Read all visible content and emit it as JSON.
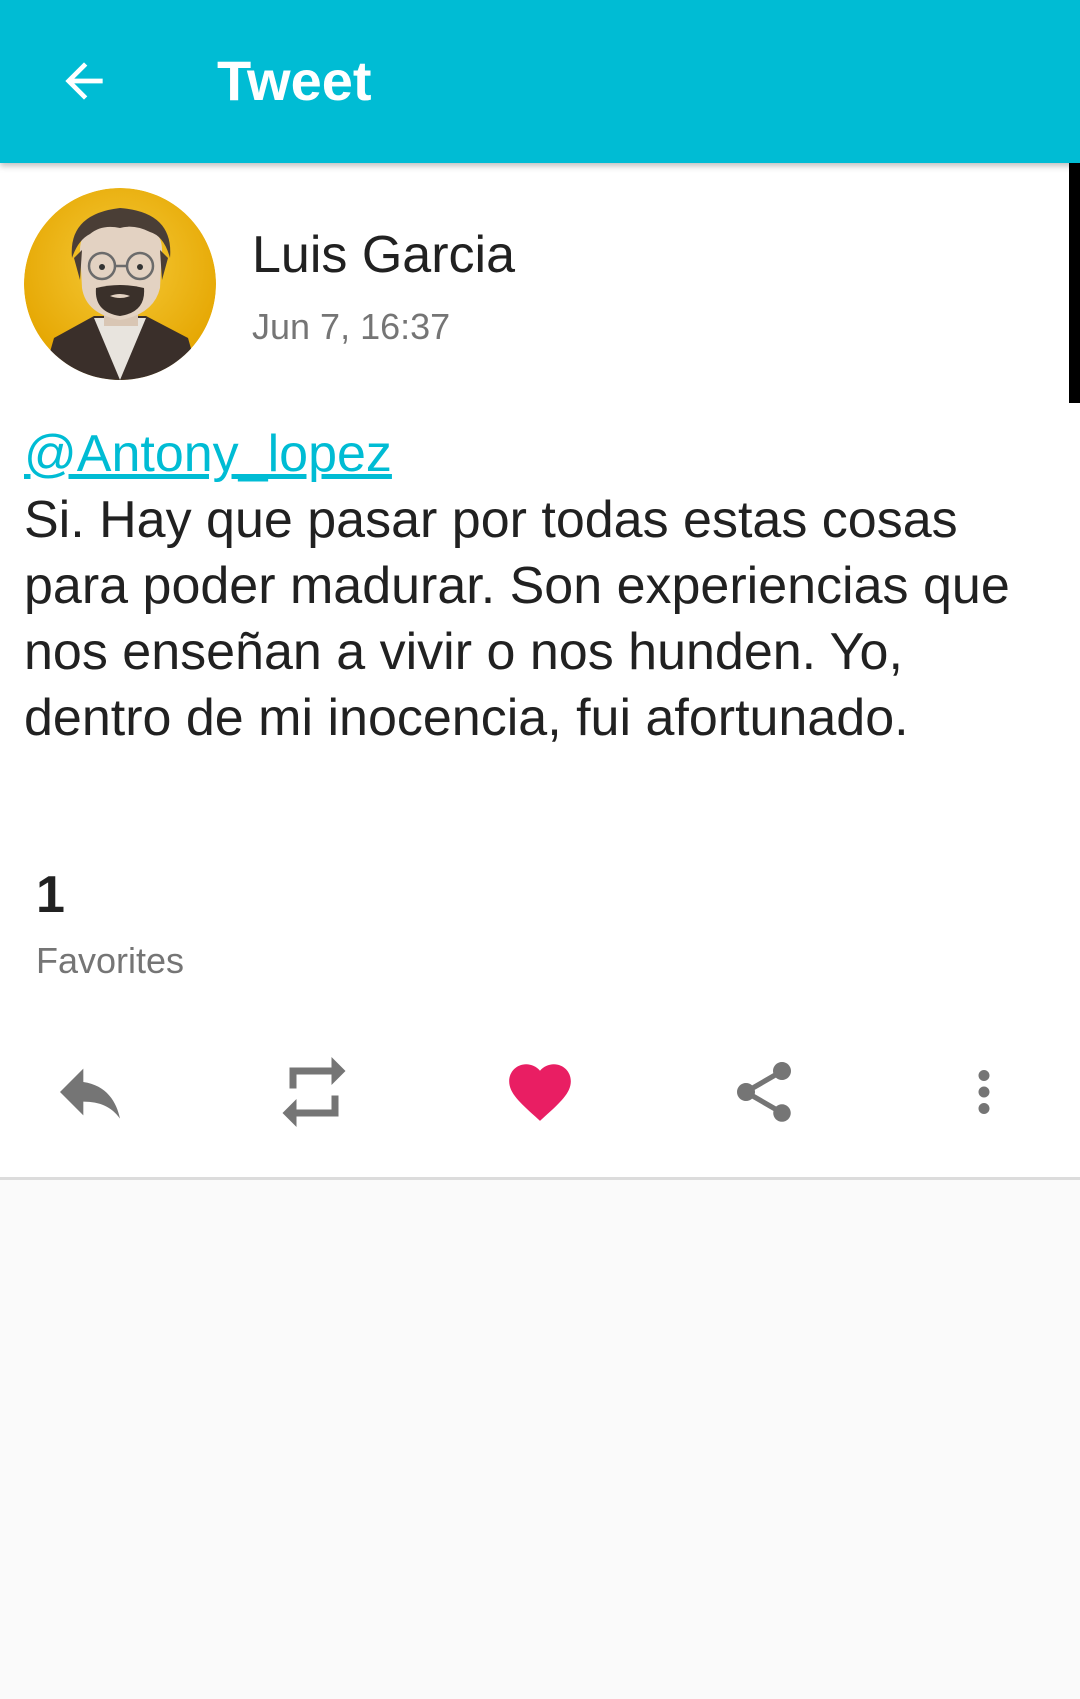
{
  "toolbar": {
    "title": "Tweet",
    "back_icon": "arrow-back-icon",
    "background_color": "#00bcd4"
  },
  "tweet": {
    "author_name": "Luis Garcia",
    "timestamp": "Jun 7, 16:37",
    "mention": "@Antony_lopez",
    "text": "Si. Hay que pasar por todas estas cosas para poder madurar. Son experiencias que nos enseñan a vivir o nos hunden. Yo, dentro de mi inocencia, fui afortunado.",
    "favorites_count": "1",
    "favorites_label": "Favorites",
    "liked": true
  },
  "actions": [
    {
      "name": "reply",
      "icon": "reply-icon"
    },
    {
      "name": "retweet",
      "icon": "retweet-icon"
    },
    {
      "name": "favorite",
      "icon": "heart-icon",
      "color": "#e91e63"
    },
    {
      "name": "share",
      "icon": "share-icon"
    },
    {
      "name": "more",
      "icon": "more-vertical-icon"
    }
  ],
  "colors": {
    "accent": "#00bcd4",
    "like": "#e91e63",
    "icon_gray": "#757575"
  }
}
